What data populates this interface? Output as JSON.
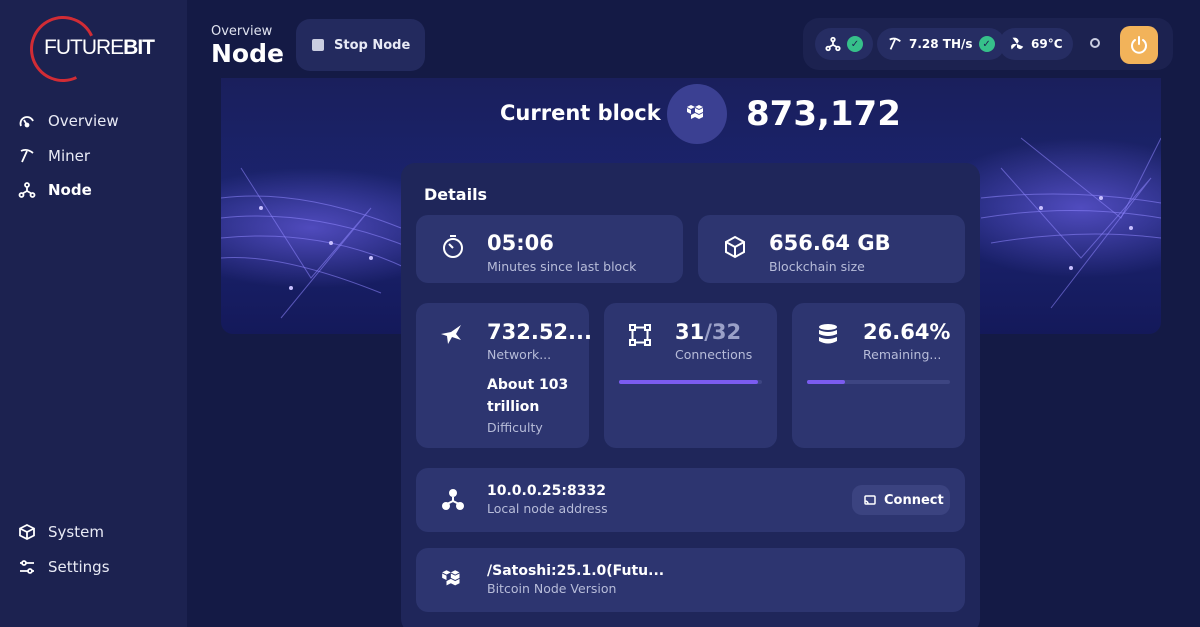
{
  "brand": {
    "logo_light": "FUTURE",
    "logo_bold": "BIT"
  },
  "sidebar": {
    "items": [
      {
        "label": "Overview",
        "icon": "overview-gauge-icon"
      },
      {
        "label": "Miner",
        "icon": "pickaxe-icon"
      },
      {
        "label": "Node",
        "icon": "node-network-icon",
        "active": true
      }
    ],
    "bottom": [
      {
        "label": "System",
        "icon": "cube-icon"
      },
      {
        "label": "Settings",
        "icon": "sliders-icon"
      }
    ]
  },
  "header": {
    "breadcrumb": "Overview",
    "title": "Node",
    "stop_label": "Stop Node"
  },
  "status": {
    "hashrate": "7.28 TH/s",
    "temperature": "69°C"
  },
  "hero": {
    "label": "Current block",
    "block": "873,172"
  },
  "details": {
    "title": "Details",
    "since_last": {
      "value": "05:06",
      "label": "Minutes since last block"
    },
    "chain_size": {
      "value": "656.64 GB",
      "label": "Blockchain size"
    },
    "network": {
      "value": "732.52...",
      "label": "Network...",
      "difficulty_value": "About 103 trillion",
      "difficulty_label": "Difficulty"
    },
    "connections": {
      "current": "31",
      "max": "/32",
      "label": "Connections",
      "fraction": 0.97
    },
    "remaining": {
      "value": "26.64%",
      "label": "Remaining...",
      "fraction": 0.2664
    },
    "address": {
      "value": "10.0.0.25:8332",
      "label": "Local node address",
      "button": "Connect"
    },
    "version": {
      "value": "/Satoshi:25.1.0(Futu...",
      "label": "Bitcoin Node Version"
    }
  },
  "colors": {
    "accent": "#7b5cf0",
    "success": "#36c08a",
    "power": "#f2b35a",
    "logo_red": "#d12c35"
  }
}
